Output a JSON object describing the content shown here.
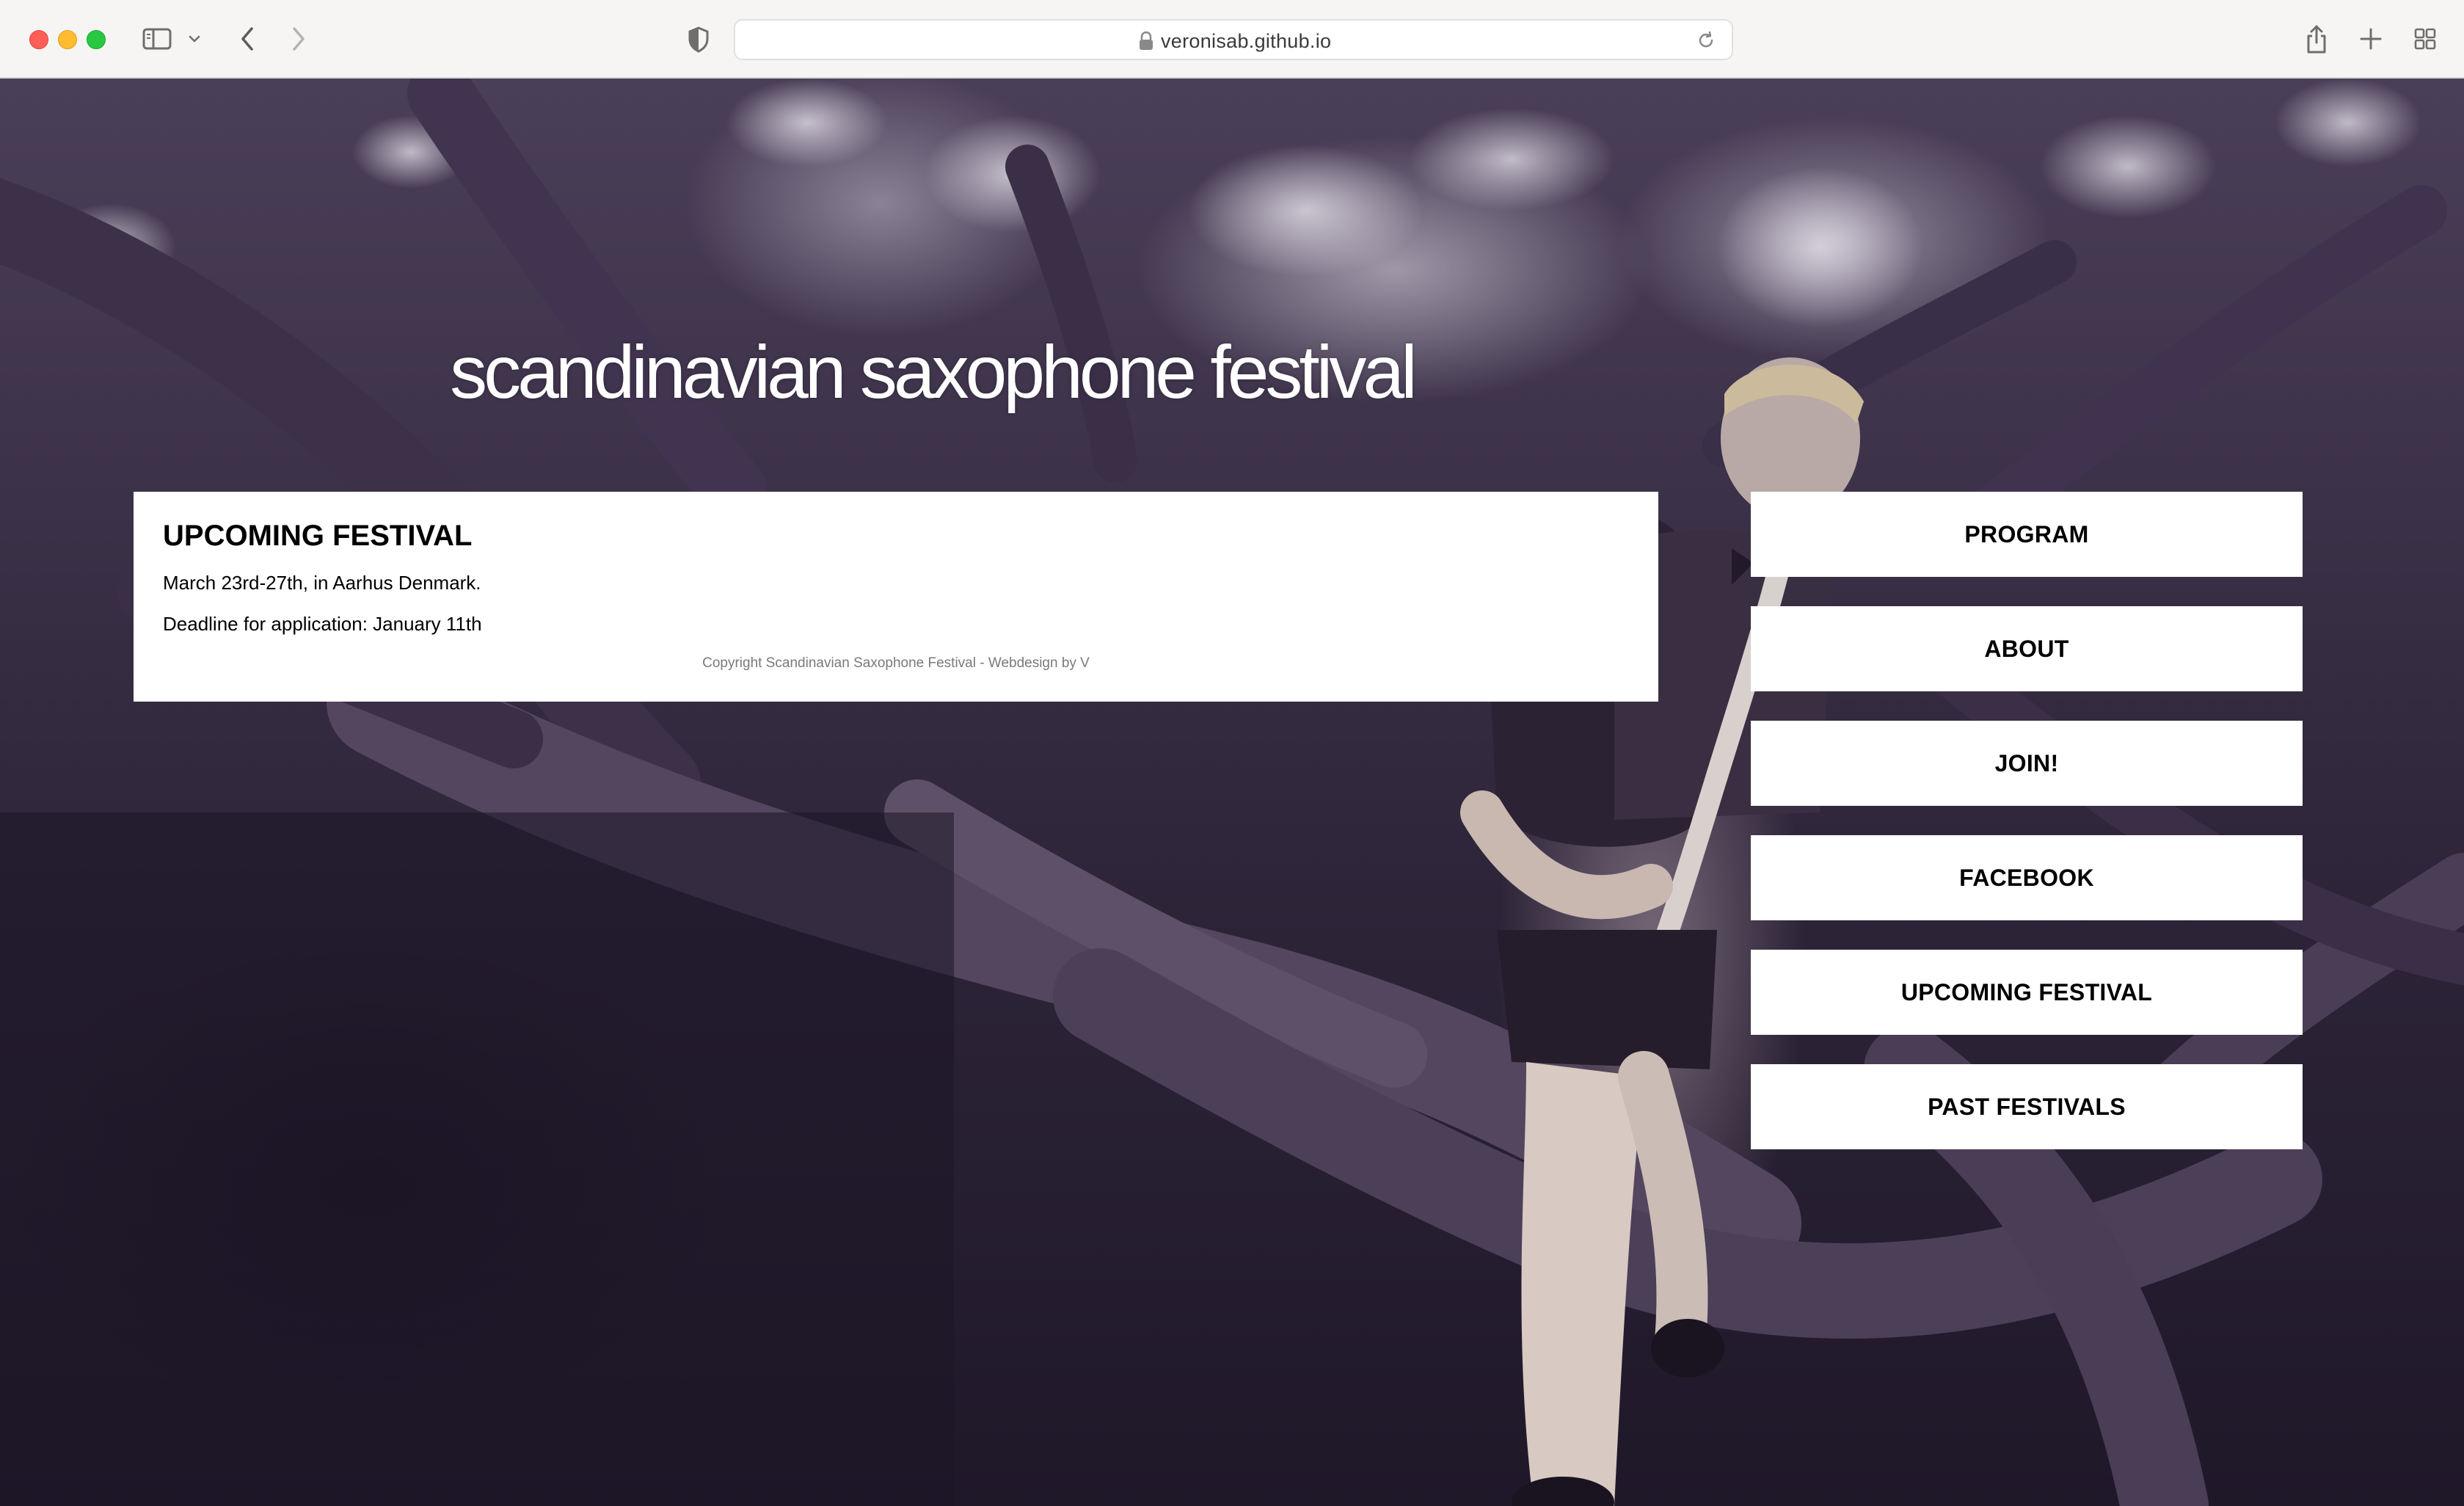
{
  "browser": {
    "url": "veronisab.github.io",
    "icons": {
      "sidebar": "sidebar-icon",
      "chevron": "chevron-down-icon",
      "back": "back-arrow-icon",
      "forward": "forward-arrow-icon",
      "shield": "privacy-shield-icon",
      "lock": "lock-icon",
      "reload": "reload-icon",
      "share": "share-icon",
      "new_tab": "plus-icon",
      "tabs": "tab-overview-icon"
    },
    "traffic_colors": {
      "close": "#ff5f57",
      "minimize": "#febc2e",
      "maximize": "#28c840"
    }
  },
  "site": {
    "title": "scandinavian saxophone festival"
  },
  "content": {
    "heading": "UPCOMING FESTIVAL",
    "line1": "March 23rd-27th, in Aarhus Denmark.",
    "line2": "Deadline for application: January 11th",
    "copyright": "Copyright Scandinavian Saxophone Festival - Webdesign by V"
  },
  "nav": {
    "items": [
      {
        "label": "PROGRAM"
      },
      {
        "label": "ABOUT"
      },
      {
        "label": "JOIN!"
      },
      {
        "label": "FACEBOOK"
      },
      {
        "label": "UPCOMING FESTIVAL"
      },
      {
        "label": "PAST FESTIVALS"
      }
    ]
  },
  "colors": {
    "panel_bg": "#ffffff",
    "text": "#000000",
    "background_tint": "#3b3148"
  }
}
